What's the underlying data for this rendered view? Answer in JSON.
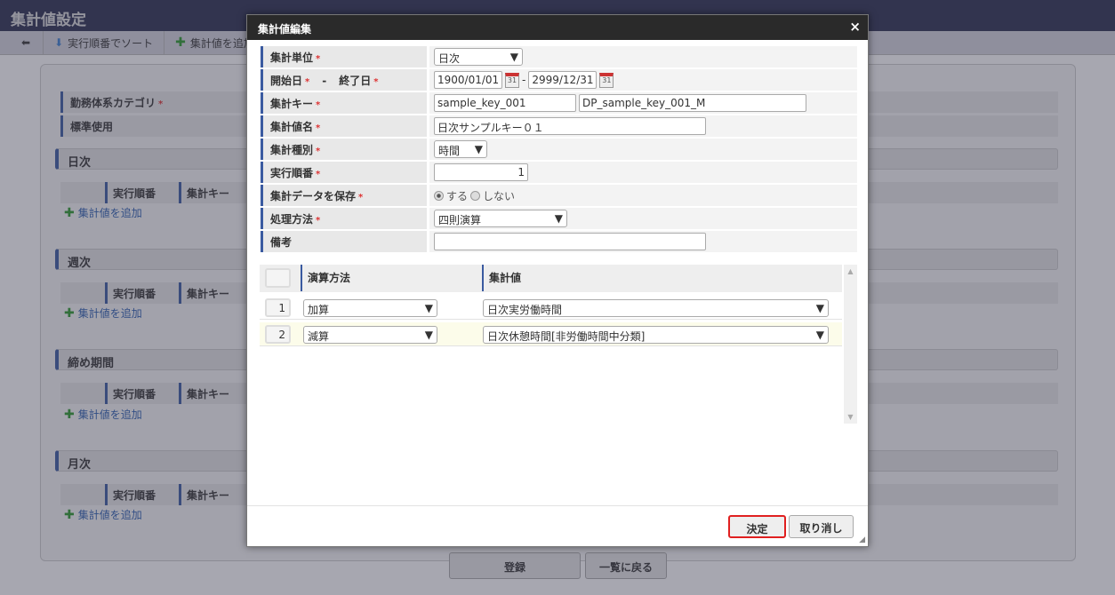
{
  "page": {
    "title": "集計値設定",
    "toolbar": {
      "back_icon": "arrow-left-icon",
      "sort_label": "実行順番でソート",
      "add_label": "集計値を追加"
    },
    "fields": [
      {
        "label": "勤務体系カテゴリ",
        "required": "*"
      },
      {
        "label": "標準使用"
      }
    ],
    "sections": [
      {
        "title": "日次"
      },
      {
        "title": "週次"
      },
      {
        "title": "締め期間"
      },
      {
        "title": "月次"
      }
    ],
    "table_headers": [
      "実行順番",
      "集計キー"
    ],
    "add_link": "集計値を追加",
    "register_button": "登録",
    "back_button": "一覧に戻る"
  },
  "dialog": {
    "title": "集計値編集",
    "close": "×",
    "req": "*",
    "labels": {
      "unit": "集計単位",
      "start": "開始日",
      "dash": "-",
      "end": "終了日",
      "key": "集計キー",
      "name": "集計値名",
      "kind": "集計種別",
      "order": "実行順番",
      "save": "集計データを保存",
      "method": "処理方法",
      "memo": "備考"
    },
    "values": {
      "unit": "日次",
      "start": "1900/01/01",
      "end": "2999/12/31",
      "cal": "31",
      "key": "sample_key_001",
      "dp_key": "DP_sample_key_001_M",
      "name": "日次サンプルキー０１",
      "kind": "時間",
      "order": "1",
      "save_yes": "する",
      "save_no": "しない",
      "method": "四則演算",
      "memo": ""
    },
    "grid": {
      "headers": [
        "演算方法",
        "集計値"
      ],
      "rows": [
        {
          "no": "1",
          "op": "加算",
          "value": "日次実労働時間"
        },
        {
          "no": "2",
          "op": "減算",
          "value": "日次休憩時間[非労働時間中分類]"
        }
      ]
    },
    "ok_button": "決定",
    "cancel_button": "取り消し"
  }
}
